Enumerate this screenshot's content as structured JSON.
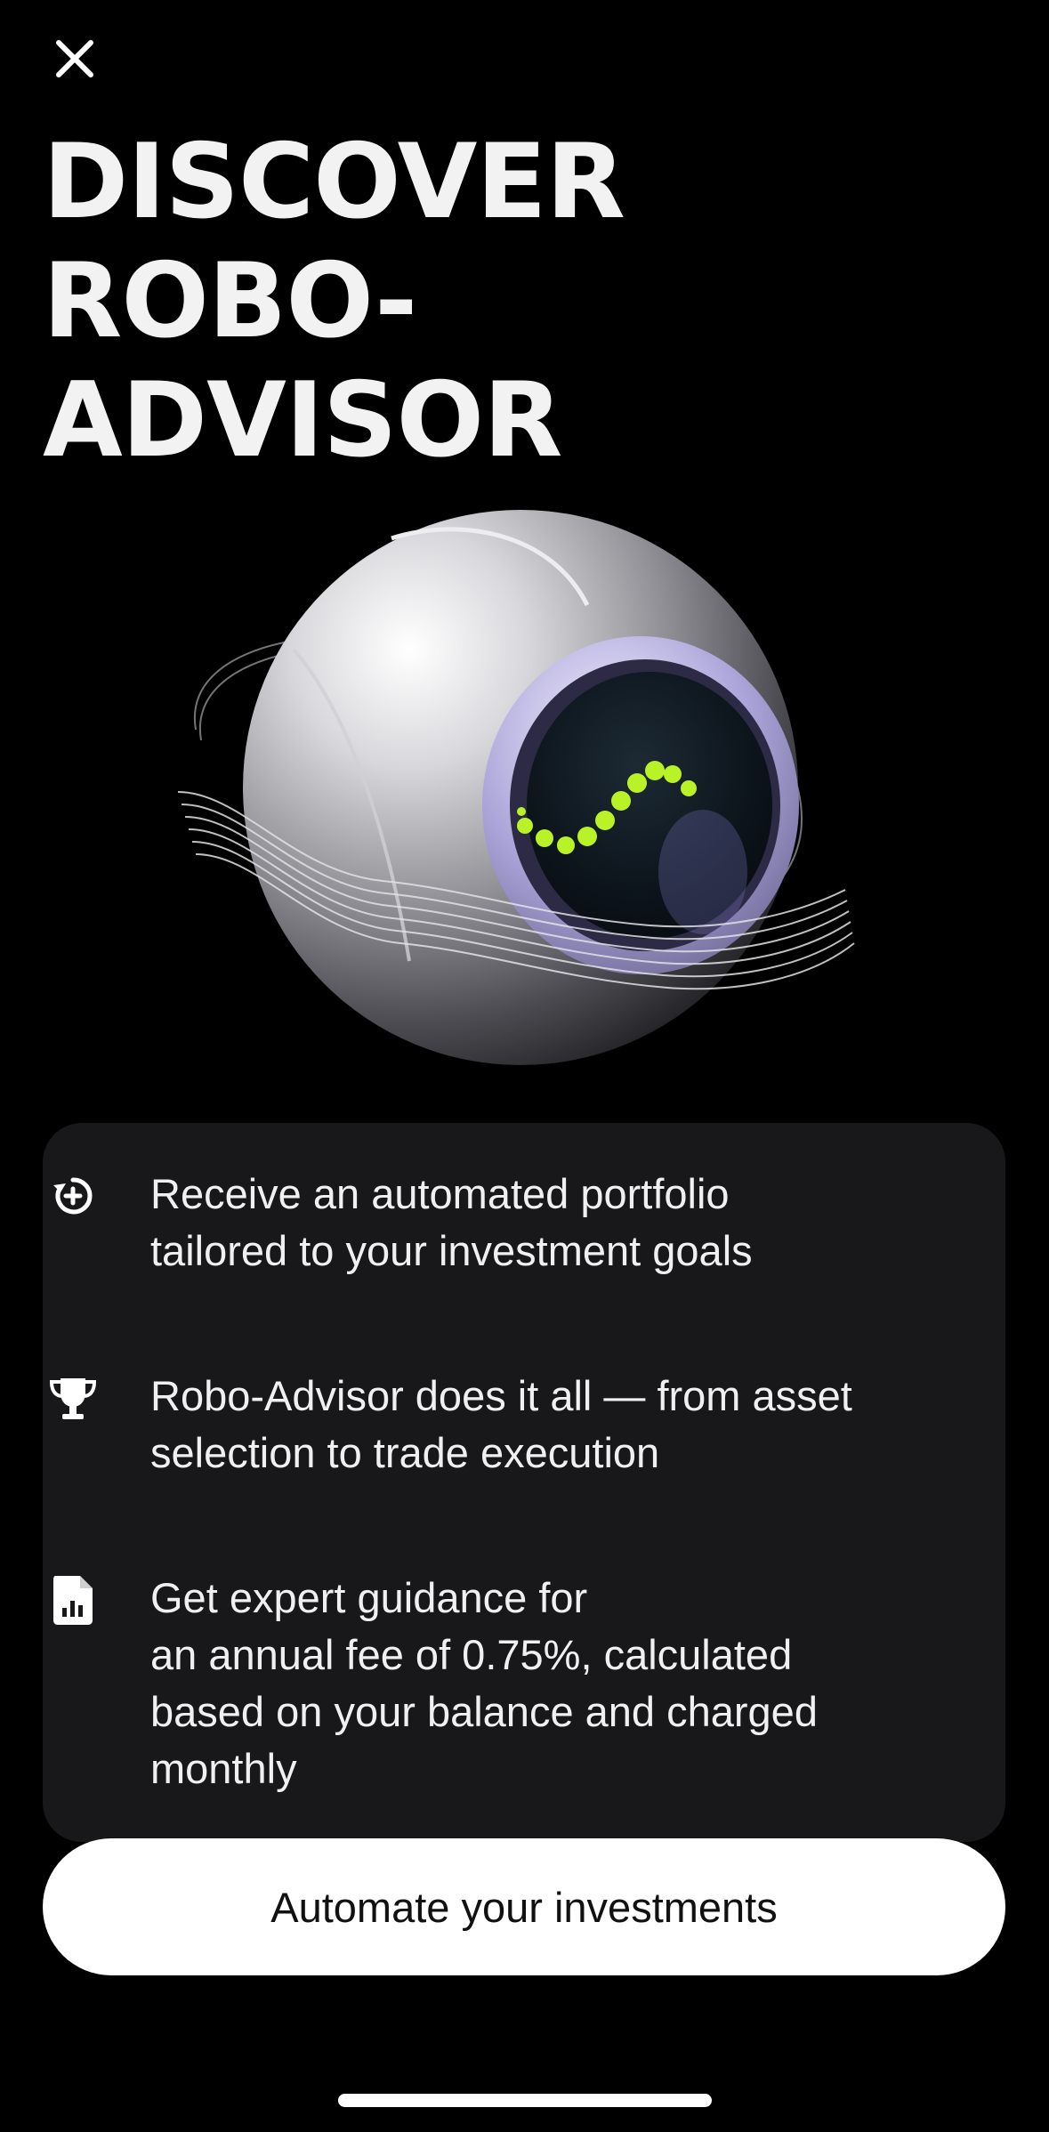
{
  "header": {
    "close_icon": "close-icon",
    "title": "DISCOVER ROBO-\nADVISOR"
  },
  "hero": {
    "illustration": "robo-advisor-sphere",
    "accent_color": "#b9f227"
  },
  "features": [
    {
      "icon": "refresh-plus-icon",
      "text": "Receive an automated portfolio\ntailored to your investment goals"
    },
    {
      "icon": "trophy-icon",
      "text": "Robo-Advisor does it all — from asset\nselection to trade execution"
    },
    {
      "icon": "document-chart-icon",
      "text": "Get expert guidance for\nan annual fee of 0.75%, calculated\nbased on your balance and charged\nmonthly"
    }
  ],
  "cta": {
    "label": "Automate your investments"
  },
  "colors": {
    "background": "#000000",
    "card": "#18181b",
    "button": "#ffffff",
    "button_text": "#111111"
  }
}
